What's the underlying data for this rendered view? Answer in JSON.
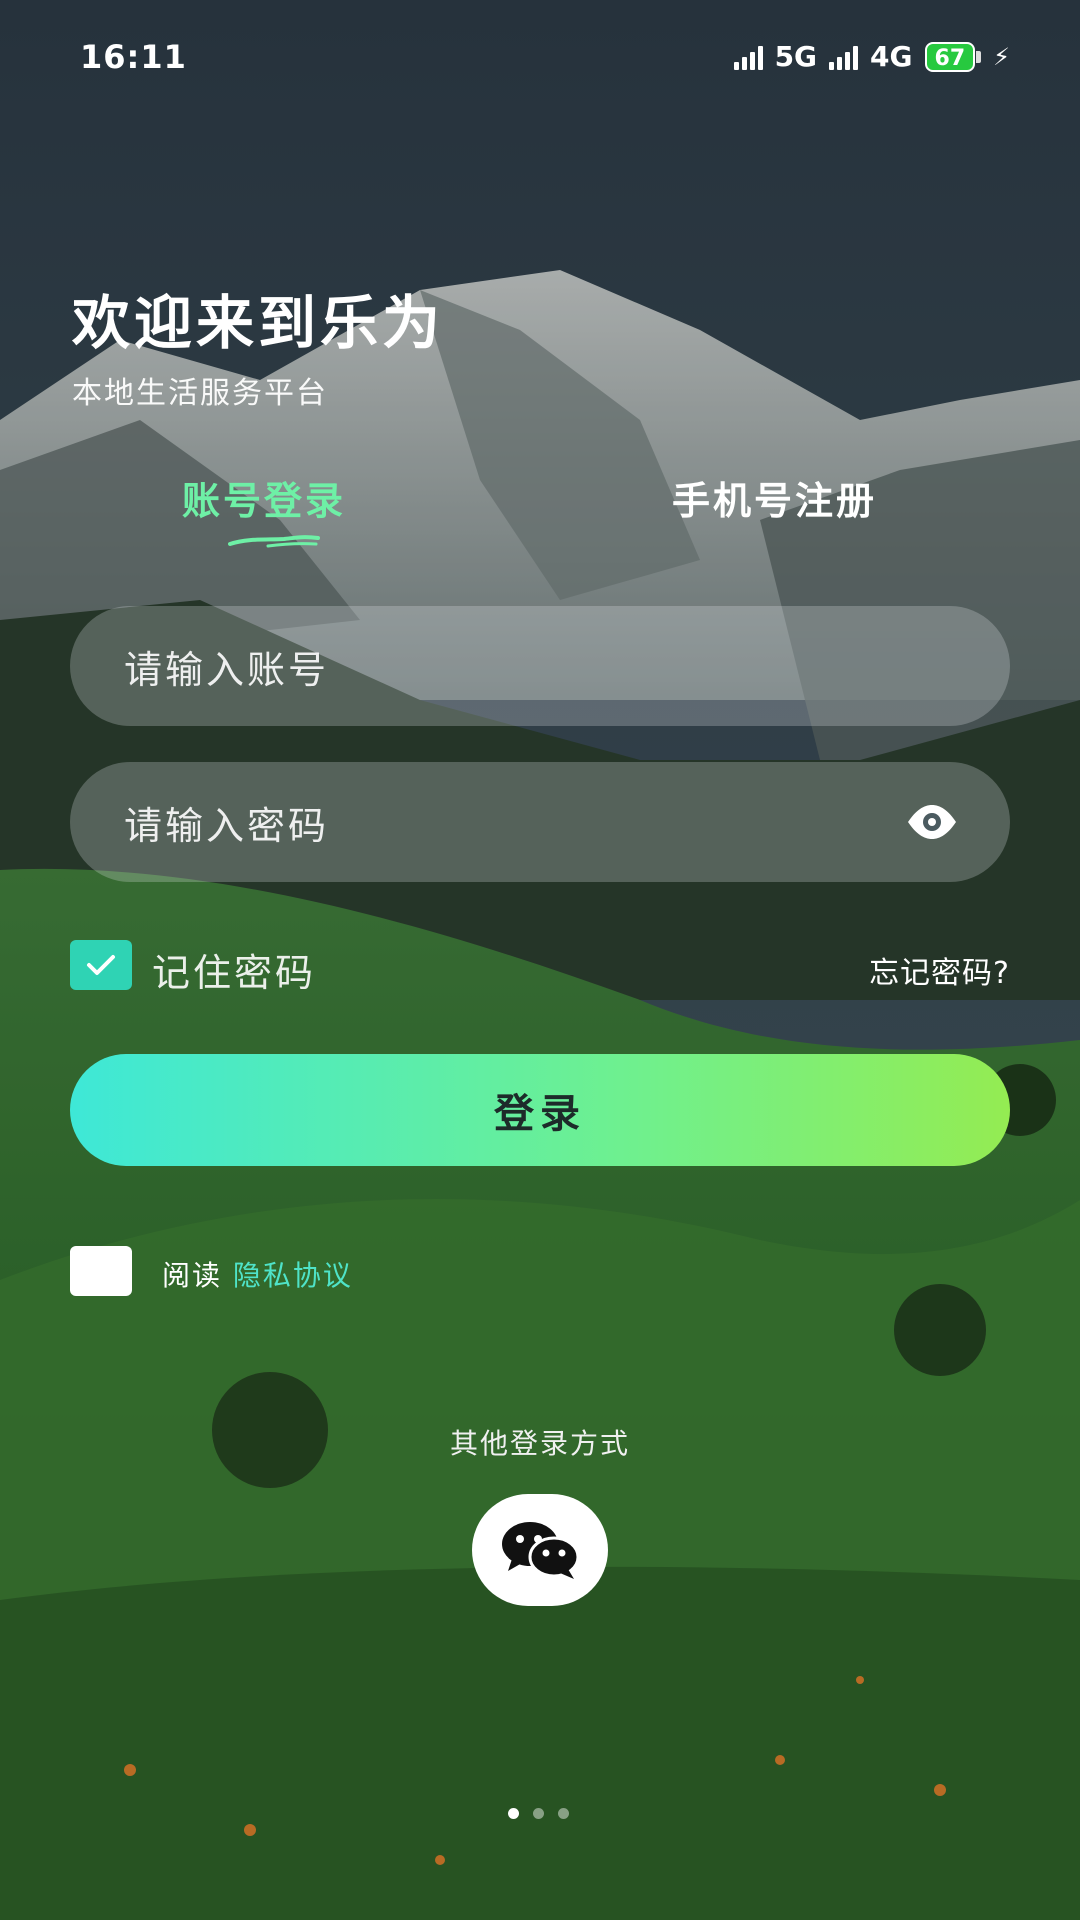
{
  "status_bar": {
    "time": "16:11",
    "network_1": "5G",
    "network_2": "4G",
    "battery": "67"
  },
  "header": {
    "title": "欢迎来到乐为",
    "subtitle": "本地生活服务平台"
  },
  "tabs": {
    "login": "账号登录",
    "register": "手机号注册",
    "active": "login",
    "active_color": "#6ef0a6"
  },
  "form": {
    "account_placeholder": "请输入账号",
    "password_placeholder": "请输入密码",
    "remember_label": "记住密码",
    "remember_checked": true,
    "forgot_label": "忘记密码?",
    "login_button": "登录"
  },
  "agreement": {
    "prefix": "阅读",
    "link": "隐私协议",
    "checked": false
  },
  "other_login": {
    "label": "其他登录方式",
    "icon": "wechat-icon"
  },
  "pager": {
    "count": 3,
    "active_index": 0
  },
  "colors": {
    "accent": "#2fd3b4",
    "button_gradient_start": "#3ee8d7",
    "button_gradient_end": "#94ec52"
  }
}
